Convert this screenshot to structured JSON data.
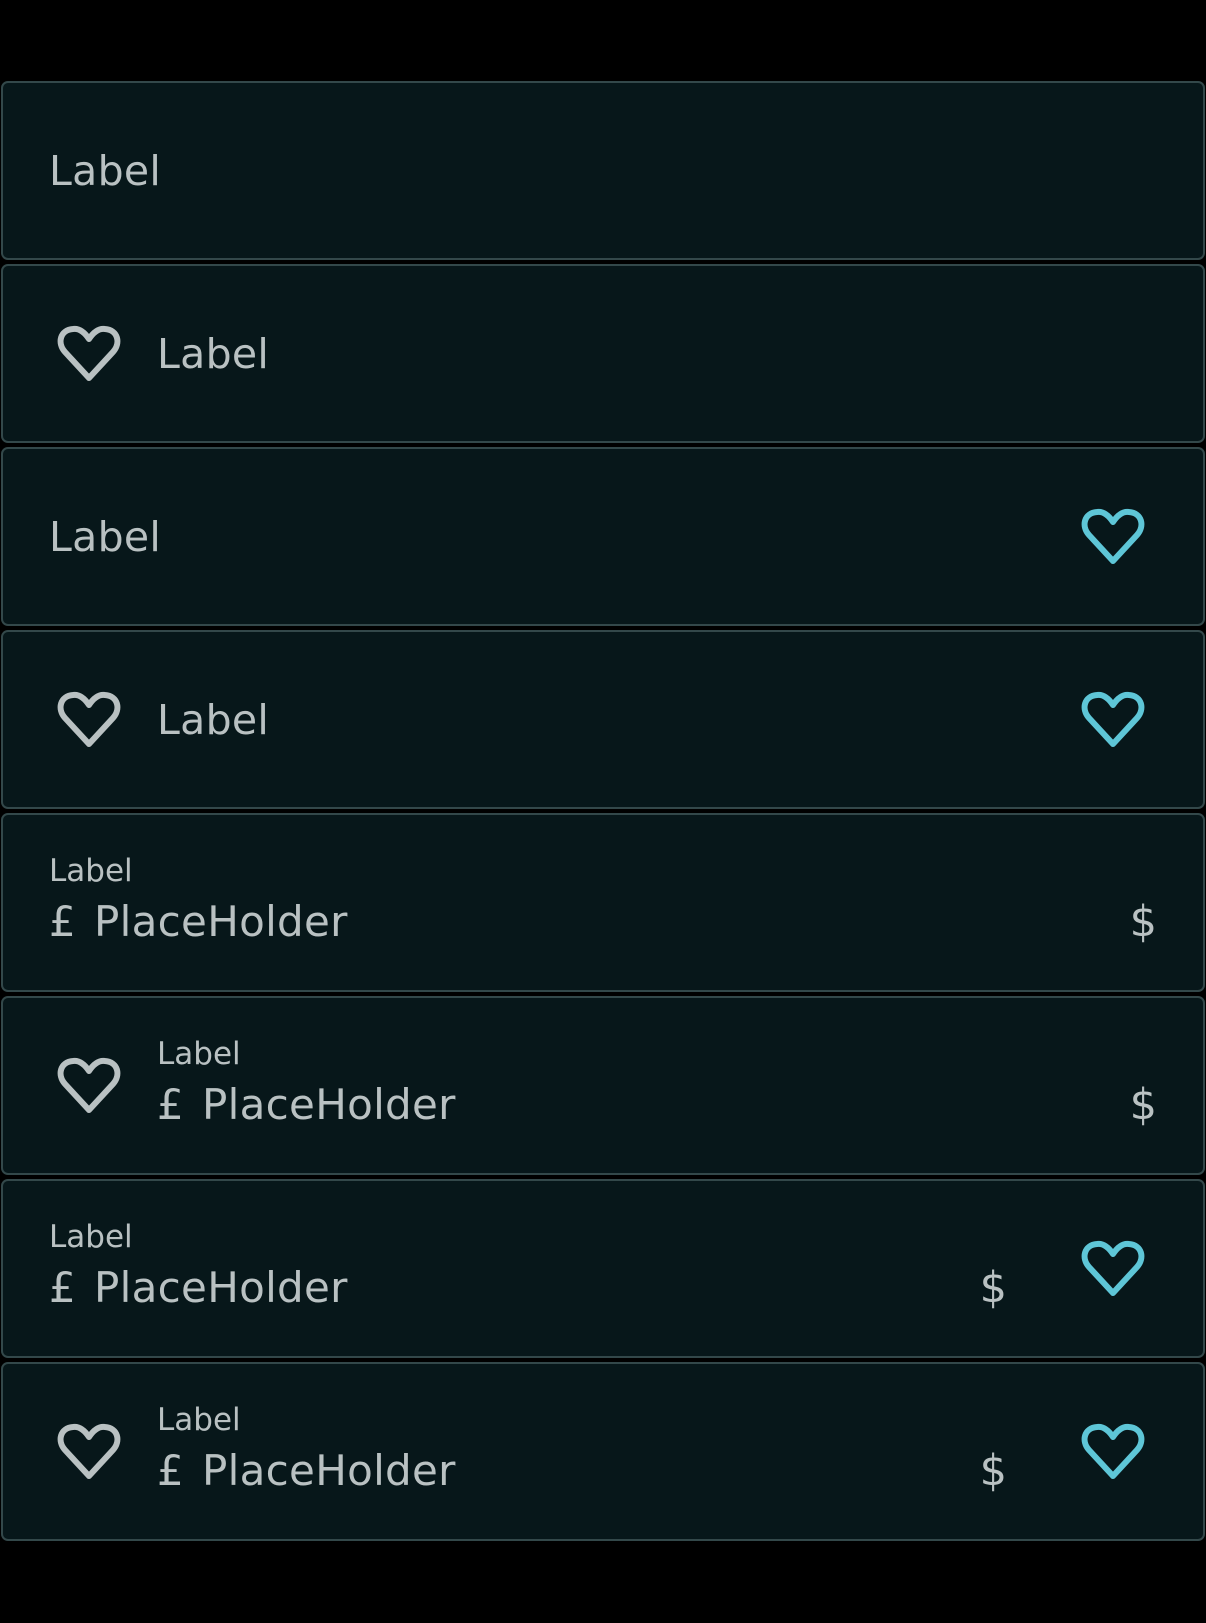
{
  "fields": [
    {
      "variant": "label",
      "label": "Label"
    },
    {
      "variant": "label-leading-icon",
      "label": "Label",
      "leading_icon": "heart-outline-icon"
    },
    {
      "variant": "label-trailing-icon",
      "label": "Label",
      "trailing_icon": "heart-outline-icon"
    },
    {
      "variant": "label-both-icons",
      "label": "Label",
      "leading_icon": "heart-outline-icon",
      "trailing_icon": "heart-outline-icon"
    },
    {
      "variant": "input",
      "label": "Label",
      "prefix": "£",
      "placeholder": "PlaceHolder",
      "suffix": "$"
    },
    {
      "variant": "input-leading-icon",
      "label": "Label",
      "prefix": "£",
      "placeholder": "PlaceHolder",
      "suffix": "$",
      "leading_icon": "heart-outline-icon"
    },
    {
      "variant": "input-trailing-icon",
      "label": "Label",
      "prefix": "£",
      "placeholder": "PlaceHolder",
      "suffix": "$",
      "trailing_icon": "heart-outline-icon"
    },
    {
      "variant": "input-both-icons",
      "label": "Label",
      "prefix": "£",
      "placeholder": "PlaceHolder",
      "suffix": "$",
      "leading_icon": "heart-outline-icon",
      "trailing_icon": "heart-outline-icon"
    }
  ],
  "colors": {
    "page_background": "#000000",
    "field_background": "#07171a",
    "field_border": "#33484a",
    "text": "#b9c1c2",
    "leading_icon": "#b9c1c2",
    "trailing_icon_accent": "#5ec6d7"
  }
}
